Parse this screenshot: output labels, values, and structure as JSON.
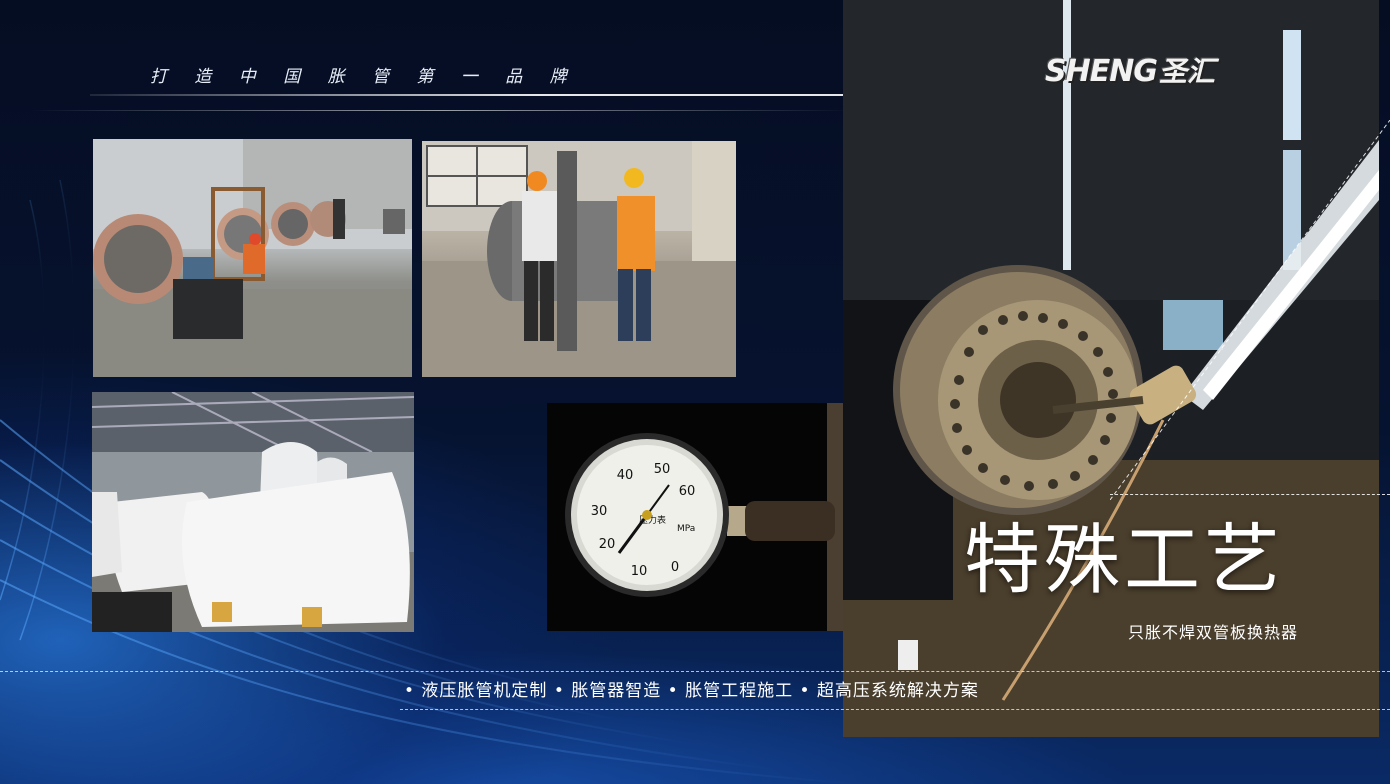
{
  "header": {
    "tagline": "打 造 中 国 胀 管 第 一 品 牌"
  },
  "logo": {
    "latin": "SHENG",
    "chinese": "圣汇"
  },
  "hero": {
    "title": "特殊工艺",
    "subtitle": "只胀不焊双管板换热器"
  },
  "footer": {
    "services": "• 液压胀管机定制 • 胀管器智造 • 胀管工程施工 • 超高压系统解决方案"
  },
  "gauge": {
    "ticks": [
      "0",
      "10",
      "20",
      "30",
      "40",
      "50",
      "60"
    ],
    "unit": "MPa",
    "label": "压力表"
  },
  "colors": {
    "background": "#06102a",
    "accent_blue": "#1e64d2",
    "text": "#ffffff"
  }
}
